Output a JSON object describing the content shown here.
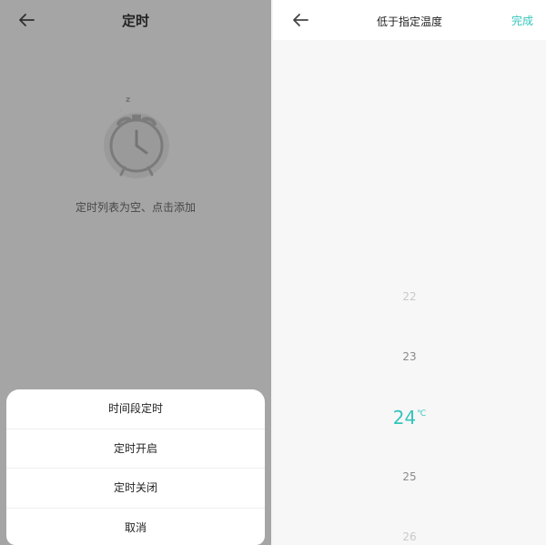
{
  "left": {
    "title": "定时",
    "empty_text": "定时列表为空、点击添加",
    "clock_badge": "z",
    "sheet": {
      "items": [
        "时间段定时",
        "定时开启",
        "定时关闭",
        "取消"
      ]
    }
  },
  "right": {
    "title": "低于指定温度",
    "done_label": "完成",
    "picker": {
      "values": [
        "22",
        "23",
        "24",
        "25",
        "26"
      ],
      "selected_index": 2,
      "unit": "℃"
    }
  },
  "colors": {
    "accent": "#33c5bb",
    "overlay": "rgba(0,0,0,0.30)"
  }
}
